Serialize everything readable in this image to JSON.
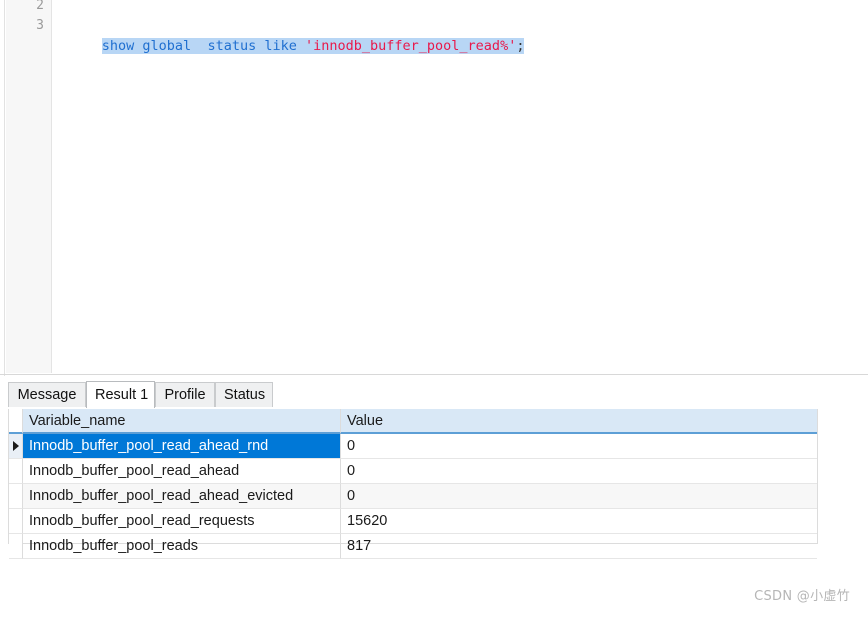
{
  "editor": {
    "gutter_lines": [
      "2",
      "3"
    ],
    "statement": {
      "tokens": [
        {
          "text": "show global ",
          "kind": "keyword"
        },
        {
          "text": " status like ",
          "kind": "keyword"
        },
        {
          "text": "'innodb_buffer_pool_read%'",
          "kind": "string"
        },
        {
          "text": ";",
          "kind": "punct"
        }
      ],
      "plain": "show global  status like 'innodb_buffer_pool_read%';"
    },
    "selection_color": "#b8d6f5",
    "keyword_color": "#1f6fd0",
    "string_color": "#e8194b"
  },
  "results": {
    "tabs": [
      {
        "label": "Message",
        "active": false
      },
      {
        "label": "Result 1",
        "active": true
      },
      {
        "label": "Profile",
        "active": false
      },
      {
        "label": "Status",
        "active": false
      }
    ],
    "grid": {
      "columns": [
        "Variable_name",
        "Value"
      ],
      "selected_row_index": 0,
      "selection_color": "#0078d7",
      "header_color": "#d9e8f6",
      "rows": [
        {
          "Variable_name": "Innodb_buffer_pool_read_ahead_rnd",
          "Value": "0"
        },
        {
          "Variable_name": "Innodb_buffer_pool_read_ahead",
          "Value": "0"
        },
        {
          "Variable_name": "Innodb_buffer_pool_read_ahead_evicted",
          "Value": "0"
        },
        {
          "Variable_name": "Innodb_buffer_pool_read_requests",
          "Value": "15620"
        },
        {
          "Variable_name": "Innodb_buffer_pool_reads",
          "Value": "817"
        }
      ]
    }
  },
  "watermark": {
    "text": "CSDN @小虚竹"
  }
}
